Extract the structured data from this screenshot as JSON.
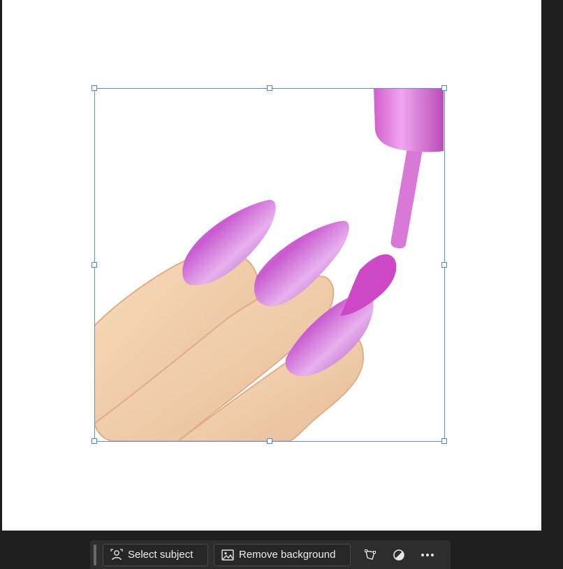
{
  "toolbar": {
    "select_subject_label": "Select subject",
    "remove_background_label": "Remove background",
    "select_subject_icon": "person-select-icon",
    "remove_background_icon": "image-icon",
    "transform_icon": "transform-icon",
    "adjust_icon": "half-circle-adjust-icon",
    "more_icon": "more-dots-icon"
  },
  "image": {
    "subject": "nail-polish-emoji",
    "icon": "nail-polish-icon"
  },
  "colors": {
    "selection_border": "#5a8fe0",
    "canvas": "#ffffff",
    "workspace": "#1e1e1e",
    "toolbar": "#2d2d2d",
    "polish": "#c95bd2",
    "skin": "#f3d2ad"
  }
}
